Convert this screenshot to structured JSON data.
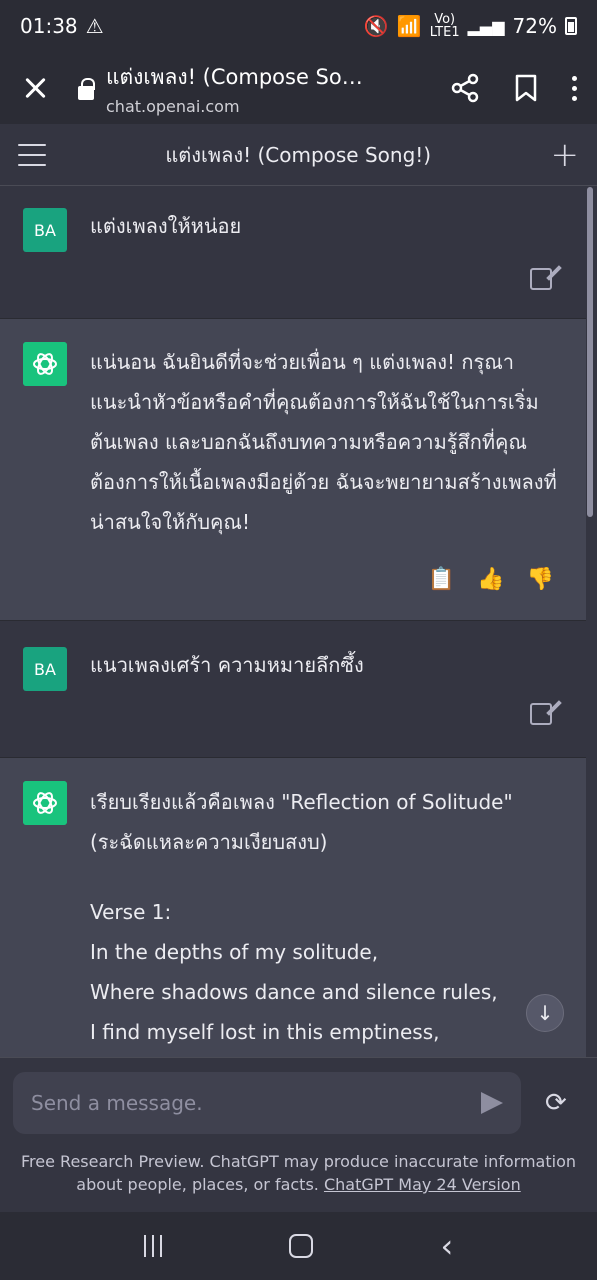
{
  "status_bar": {
    "time": "01:38",
    "battery": "72%",
    "volte_label": "Vo)\nLTE1"
  },
  "browser": {
    "page_title": "แต่งเพลง! (Compose Son…",
    "url": "chat.openai.com",
    "icons": [
      "close-icon",
      "lock-icon",
      "share-icon",
      "bookmark-icon",
      "more-icon"
    ]
  },
  "app_header": {
    "title": "แต่งเพลง! (Compose Song!)"
  },
  "messages": [
    {
      "role": "user",
      "avatar": "BA",
      "text": "แต่งเพลงให้หน่อย"
    },
    {
      "role": "assistant",
      "text": "แน่นอน ฉันยินดีที่จะช่วยเพื่อน ๆ แต่งเพลง! กรุณาแนะนำหัวข้อหรือคำที่คุณต้องการให้ฉันใช้ในการเริ่มต้นเพลง และบอกฉันถึงบทความหรือความรู้สึกที่คุณต้องการให้เนื้อเพลงมีอยู่ด้วย ฉันจะพยายามสร้างเพลงที่น่าสนใจให้กับคุณ!"
    },
    {
      "role": "user",
      "avatar": "BA",
      "text": "แนวเพลงเศร้า ความหมายลึกซึ้ง"
    },
    {
      "role": "assistant",
      "lines": [
        "เรียบเรียงแล้วคือเพลง \"Reflection of Solitude\"",
        "(ระฉัดแหละความเงียบสงบ)",
        "",
        "Verse 1:",
        "In the depths of my solitude,",
        "Where shadows dance and silence rules,",
        "I find myself lost in this emptiness,"
      ]
    }
  ],
  "composer": {
    "placeholder": "Send a message.",
    "footer_text": "Free Research Preview. ChatGPT may produce inaccurate information about people, places, or facts. ",
    "footer_link": "ChatGPT May 24 Version"
  },
  "colors": {
    "background": "#343541",
    "assistant_bg": "#444654",
    "user_avatar": "#19a37f",
    "assistant_avatar": "#19c37d"
  }
}
